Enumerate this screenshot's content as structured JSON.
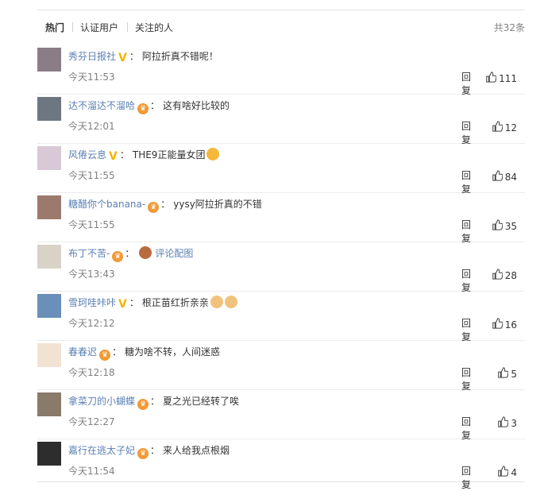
{
  "tabs": [
    "热门",
    "认证用户",
    "关注的人"
  ],
  "total": "共32条",
  "comments": [
    {
      "user": "秀芬日报社",
      "badge": "vbadge",
      "colon": "：",
      "text": "阿拉折真不错呢！",
      "time": "今天11:53",
      "reply": "回复",
      "likes": "111",
      "avatar": "#8b7d86",
      "avatarIcon": "person-photo-icon"
    },
    {
      "user": "达不溜达不溜哈",
      "badge": "crown",
      "colon": "：",
      "text": "这有啥好比较的",
      "time": "今天12:01",
      "reply": "回复",
      "likes": "12",
      "avatar": "#6d7681",
      "avatarIcon": "cat-photo-icon"
    },
    {
      "user": "风倦云息",
      "badge": "vbadge",
      "colon": "：",
      "text": "THE9正能量女团",
      "time": "今天11:55",
      "reply": "回复",
      "likes": "84",
      "avatar": "#d9c8d6",
      "avatarIcon": "anime-avatar-icon",
      "emoji": "heart-eyes-emoji"
    },
    {
      "user": "糖醋你个banana-",
      "badge": "crown",
      "colon": "：",
      "text": "yysy阿拉折真的不错",
      "time": "今天11:55",
      "reply": "回复",
      "likes": "35",
      "avatar": "#9b7a6d",
      "avatarIcon": "photo-icon"
    },
    {
      "user": "布丁不苦-",
      "badge": "crown",
      "colon": "：",
      "text": "评论配图",
      "time": "今天13:43",
      "reply": "回复",
      "likes": "28",
      "avatar": "#d9d3c7",
      "avatarIcon": "cat-cartoon-icon",
      "prefixEmoji": "bear-emoji"
    },
    {
      "user": "雪珂哇咔咔",
      "badge": "vbadge",
      "colon": "：",
      "text": "根正苗红折亲亲",
      "time": "今天12:12",
      "reply": "回复",
      "likes": "16",
      "avatar": "#6a8fb8",
      "avatarIcon": "sailor-moon-icon",
      "emoji": "thumbs-up-emoji",
      "emoji2": "thumbs-up-emoji"
    },
    {
      "user": "春春迟",
      "badge": "crown",
      "colon": "：",
      "text": "糖为啥不转，人间迷惑",
      "time": "今天12:18",
      "reply": "回复",
      "likes": "5",
      "avatar": "#f2e2d3",
      "avatarIcon": "pattern-avatar-icon"
    },
    {
      "user": "拿菜刀的小蝴蝶",
      "badge": "crown",
      "colon": "：",
      "text": "夏之光已经转了唉",
      "time": "今天12:27",
      "reply": "回复",
      "likes": "3",
      "avatar": "#8a7a6a",
      "avatarIcon": "photo-icon"
    },
    {
      "user": "嘉行在逃太子妃",
      "badge": "crown",
      "colon": "：",
      "text": "来人给我点根烟",
      "time": "今天11:54",
      "reply": "回复",
      "likes": "4",
      "avatar": "#2d2d2d",
      "avatarIcon": "sunglasses-avatar-icon"
    }
  ],
  "colors": {
    "name": "#5a7fb3",
    "vbadge": "#f4b400",
    "crown": "#f29a38"
  }
}
